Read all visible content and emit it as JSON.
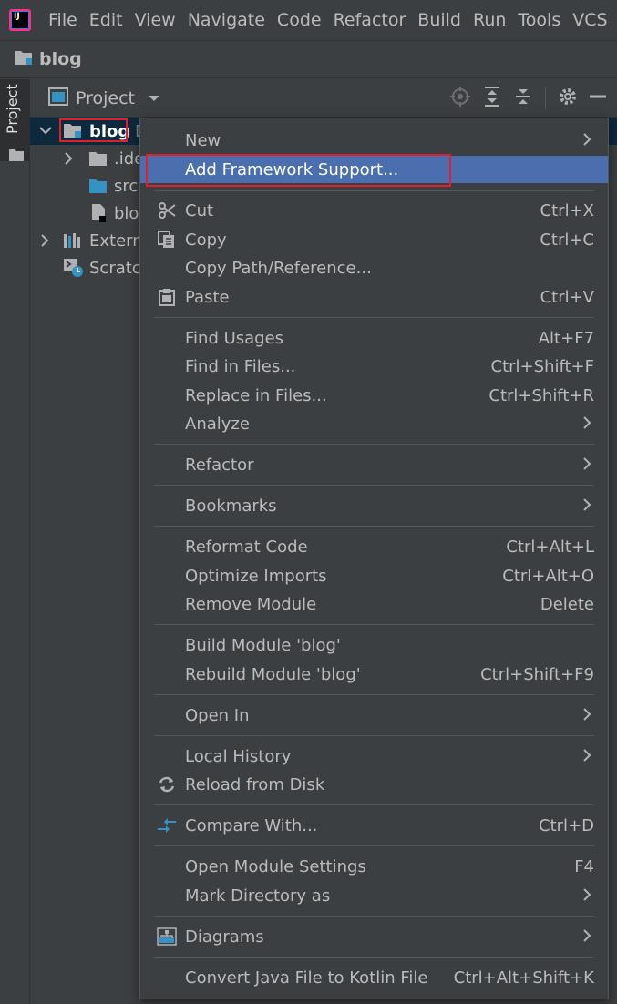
{
  "menubar": {
    "logo_text": "IJ",
    "items": [
      "File",
      "Edit",
      "View",
      "Navigate",
      "Code",
      "Refactor",
      "Build",
      "Run",
      "Tools",
      "VCS"
    ]
  },
  "navbar": {
    "project_name": "blog"
  },
  "leftstrip": {
    "project_tab": "Project"
  },
  "panel": {
    "title": "Project",
    "tree": [
      {
        "label": "blog",
        "suffix": "D"
      },
      {
        "label": ".ide"
      },
      {
        "label": "src"
      },
      {
        "label": "blo"
      },
      {
        "label": "Extern"
      },
      {
        "label": "Scratcl"
      }
    ]
  },
  "context_menu": {
    "new": "New",
    "add_framework": "Add Framework Support...",
    "cut": "Cut",
    "cut_shortcut": "Ctrl+X",
    "copy": "Copy",
    "copy_shortcut": "Ctrl+C",
    "copy_path": "Copy Path/Reference...",
    "paste": "Paste",
    "paste_shortcut": "Ctrl+V",
    "find_usages": "Find Usages",
    "find_usages_shortcut": "Alt+F7",
    "find_in_files": "Find in Files...",
    "find_in_files_shortcut": "Ctrl+Shift+F",
    "replace_in_files": "Replace in Files...",
    "replace_in_files_shortcut": "Ctrl+Shift+R",
    "analyze": "Analyze",
    "refactor": "Refactor",
    "bookmarks": "Bookmarks",
    "reformat": "Reformat Code",
    "reformat_shortcut": "Ctrl+Alt+L",
    "optimize": "Optimize Imports",
    "optimize_shortcut": "Ctrl+Alt+O",
    "remove_module": "Remove Module",
    "remove_module_shortcut": "Delete",
    "build_module": "Build Module 'blog'",
    "rebuild_module": "Rebuild Module 'blog'",
    "rebuild_module_shortcut": "Ctrl+Shift+F9",
    "open_in": "Open In",
    "local_history": "Local History",
    "reload": "Reload from Disk",
    "compare": "Compare With...",
    "compare_shortcut": "Ctrl+D",
    "module_settings": "Open Module Settings",
    "module_settings_shortcut": "F4",
    "mark_dir": "Mark Directory as",
    "diagrams": "Diagrams",
    "convert": "Convert Java File to Kotlin File",
    "convert_shortcut": "Ctrl+Alt+Shift+K"
  },
  "colors": {
    "background": "#3c3f41",
    "selection": "#4b6eaf",
    "highlight_border": "#e0202a",
    "folder_blue": "#3592c4"
  }
}
